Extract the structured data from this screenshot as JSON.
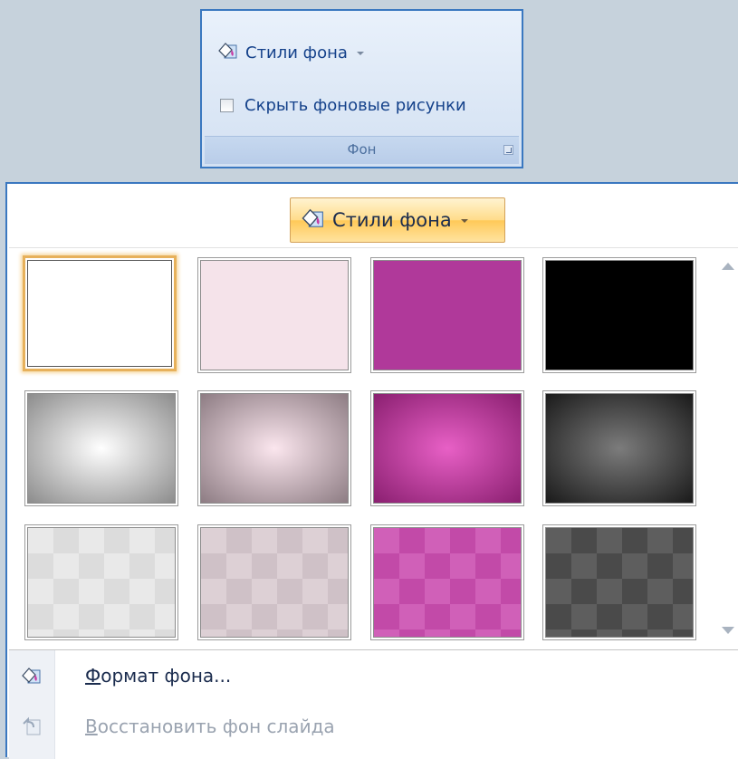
{
  "ribbon": {
    "styles_button_label": "Стили фона",
    "hide_graphics_label": "Скрыть фоновые рисунки",
    "hide_graphics_checked": false,
    "group_label": "Фон"
  },
  "gallery": {
    "header_button_label": "Стили фона",
    "selected_index": 0,
    "styles": [
      {
        "style": "solid",
        "colors": [
          "#ffffff"
        ]
      },
      {
        "style": "solid",
        "colors": [
          "#f5e3ea"
        ]
      },
      {
        "style": "solid",
        "colors": [
          "#b0399a"
        ]
      },
      {
        "style": "solid",
        "colors": [
          "#000000"
        ]
      },
      {
        "style": "radial",
        "colors": [
          "#ffffff",
          "#8c8c8c"
        ]
      },
      {
        "style": "radial",
        "colors": [
          "#fbe6ee",
          "#8d7c83"
        ]
      },
      {
        "style": "radial",
        "colors": [
          "#e860c6",
          "#8a1f70"
        ]
      },
      {
        "style": "radial",
        "colors": [
          "#7c7c7c",
          "#1a1a1a"
        ]
      },
      {
        "style": "pattern",
        "colors": [
          "#e9e9e9",
          "#dcdcdc"
        ]
      },
      {
        "style": "pattern",
        "colors": [
          "#ddd0d5",
          "#cfc1c7"
        ]
      },
      {
        "style": "pattern",
        "colors": [
          "#d060b8",
          "#c24aa8"
        ]
      },
      {
        "style": "pattern",
        "colors": [
          "#5e5e5e",
          "#4a4a4a"
        ]
      }
    ]
  },
  "menu": {
    "format_background_label": "Формат фона...",
    "reset_background_label": "Восстановить фон слайда",
    "reset_enabled": false
  },
  "colors": {
    "accent_border": "#3a78c0",
    "ribbon_text": "#15428b",
    "hover_orange": "#ffc958",
    "selection_gold": "#e7b15b"
  },
  "icons": {
    "styles_button": "paint-bucket-icon",
    "format_background": "paint-bucket-icon",
    "reset_background": "reset-slide-icon"
  }
}
